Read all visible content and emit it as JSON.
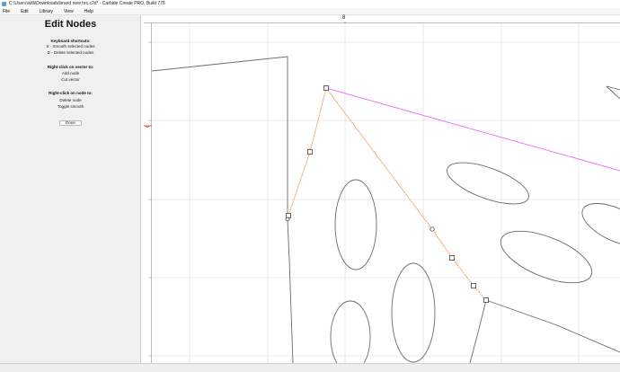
{
  "window": {
    "title": "C:\\Users\\willi\\Downloads\\brand new hrc.c2d* - Carbide Create PRO, Build 778"
  },
  "menu": [
    "File",
    "Edit",
    "Library",
    "View",
    "Help"
  ],
  "panel": {
    "title": "Edit Nodes",
    "keyboard_heading": "Keyboard shortcuts:",
    "keyboard_lines": [
      "S - Smooth selected nodes",
      "D - Delete selected nodes"
    ],
    "vector_heading": "Right-click on vector to:",
    "vector_lines": [
      "Add node",
      "Cut vector"
    ],
    "node_heading": "Right-click on node to:",
    "node_lines": [
      "Delete node",
      "Toggle smooth"
    ],
    "done_label": "Done"
  },
  "ruler": {
    "top_label": "8"
  },
  "colors": {
    "selected_path": "#f08a3c",
    "magenta_line": "#ee66ee",
    "vector": "#6b6b6b",
    "grid": "#d8d8d8"
  },
  "icons": {
    "app": "app-icon",
    "smooth_node": "circle-node-icon",
    "corner_node": "square-node-icon"
  }
}
